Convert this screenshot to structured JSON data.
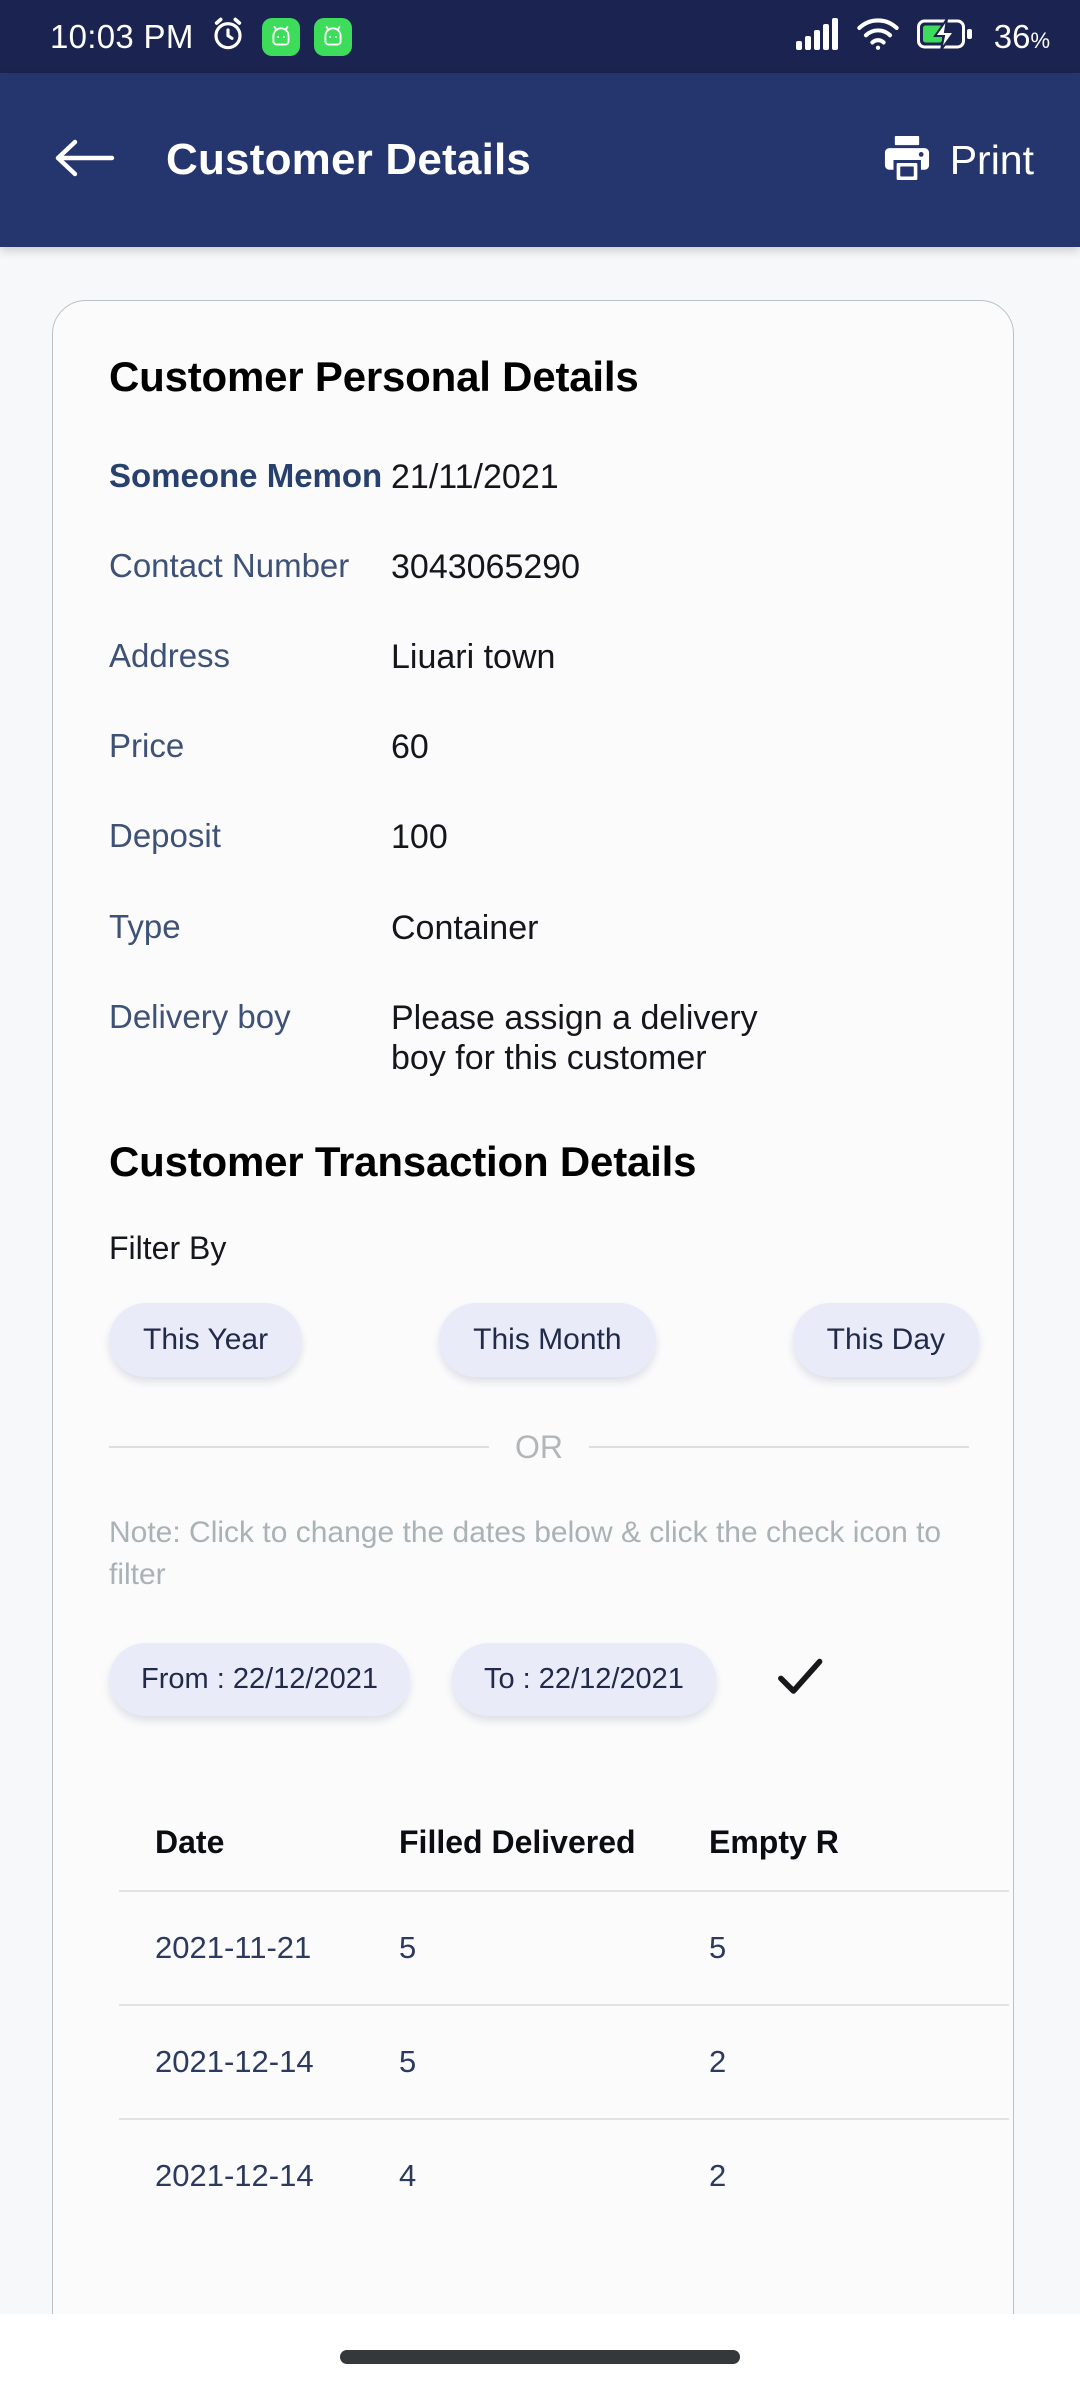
{
  "status_bar": {
    "time": "10:03 PM",
    "icons": [
      "alarm-icon",
      "app-notification-icon",
      "app-notification-icon"
    ],
    "signal_icon": "cellular-signal-icon",
    "wifi_icon": "wifi-icon",
    "battery_icon": "battery-charging-icon",
    "battery_percent": "36",
    "battery_percent_symbol": "%",
    "background_color": "#1b2450"
  },
  "app_bar": {
    "back_icon": "arrow-left-icon",
    "title": "Customer Details",
    "print_icon": "printer-icon",
    "print_label": "Print",
    "background_color": "#25356d"
  },
  "personal": {
    "section_title": "Customer Personal Details",
    "rows": [
      {
        "label": "Someone Memon",
        "value": "21/11/2021",
        "emphasis": true
      },
      {
        "label": "Contact Number",
        "value": "3043065290",
        "emphasis": false
      },
      {
        "label": "Address",
        "value": "Liuari town",
        "emphasis": false
      },
      {
        "label": "Price",
        "value": "60",
        "emphasis": false
      },
      {
        "label": "Deposit",
        "value": "100",
        "emphasis": false
      },
      {
        "label": "Type",
        "value": "Container",
        "emphasis": false
      },
      {
        "label": "Delivery boy",
        "value": "Please assign a delivery boy for this customer",
        "emphasis": false
      }
    ]
  },
  "transactions": {
    "section_title": "Customer Transaction Details",
    "filter_by_label": "Filter By",
    "filter_chips": [
      {
        "label": "This Year"
      },
      {
        "label": "This Month"
      },
      {
        "label": "This Day"
      }
    ],
    "or_text": "OR",
    "note": "Note: Click to change the dates below & click the check icon to filter",
    "from_chip_label": "From : 22/12/2021",
    "to_chip_label": "To : 22/12/2021",
    "confirm_icon": "check-icon",
    "table": {
      "columns": [
        "Date",
        "Filled Delivered",
        "Empty R"
      ],
      "rows": [
        {
          "date": "2021-11-21",
          "filled_delivered": "5",
          "empty_received": "5"
        },
        {
          "date": "2021-12-14",
          "filled_delivered": "5",
          "empty_received": "2"
        },
        {
          "date": "2021-12-14",
          "filled_delivered": "4",
          "empty_received": "2"
        }
      ]
    }
  },
  "system_nav": {
    "home_indicator": "home-indicator"
  },
  "colors": {
    "status_bar": "#1b2450",
    "app_bar": "#25356d",
    "chip_bg": "#e9ecf8",
    "chip_text": "#222a49",
    "label_text": "#3e5176",
    "accent_green": "#3ddc5b"
  }
}
